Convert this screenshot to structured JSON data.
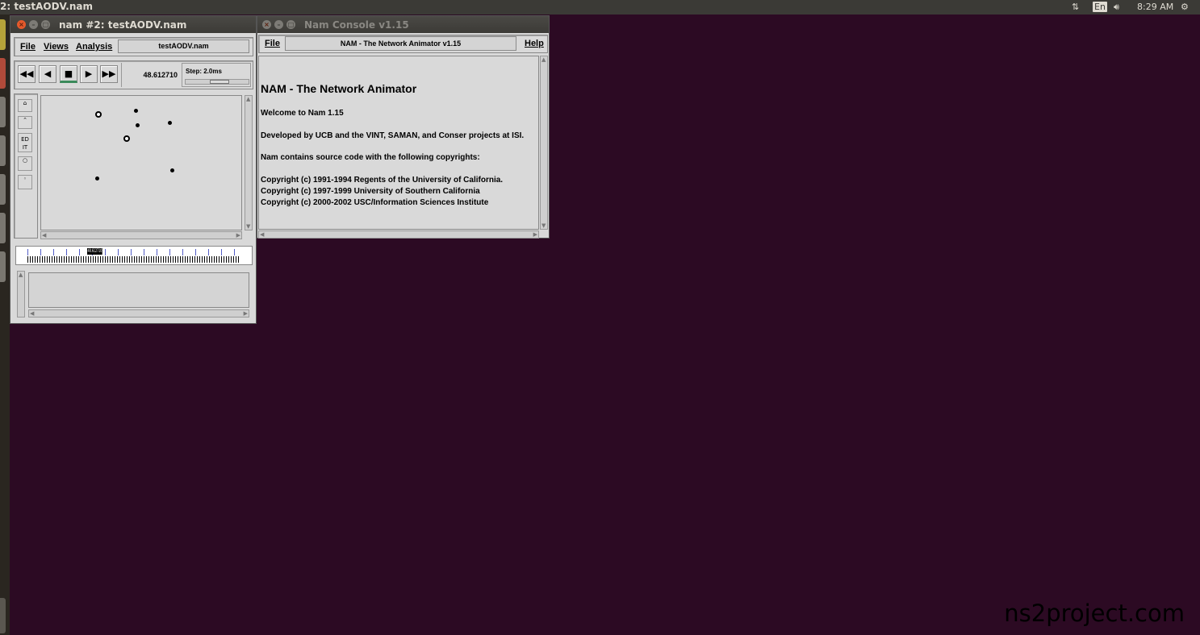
{
  "topbar": {
    "title": "2: testAODV.nam",
    "lang": "En",
    "time": "8:29 AM"
  },
  "nam_window": {
    "title": "nam #2: testAODV.nam",
    "menus": [
      "File",
      "Views",
      "Analysis"
    ],
    "file_field": "testAODV.nam",
    "time_value": "48.612710",
    "step_label": "Step: 2.0ms",
    "playback": [
      "rewind-icon",
      "play-back-icon",
      "stop-icon",
      "play-icon",
      "fast-forward-icon"
    ],
    "edit_label": "ED IT",
    "timeline_marker": "48.612710"
  },
  "console_window": {
    "title": "Nam Console v1.15",
    "menu_file": "File",
    "menu_help": "Help",
    "header_field": "NAM - The Network Animator v1.15",
    "heading": "NAM - The Network Animator",
    "lines": [
      "Welcome to Nam 1.15",
      "Developed by UCB and the VINT, SAMAN, and Conser projects at ISI.",
      "Nam contains source code with the following copyrights:",
      "Copyright (c) 1991-1994 Regents of the University of California.",
      "Copyright (c) 1997-1999 University of Southern California",
      "Copyright (c) 2000-2002 USC/Information Sciences Institute"
    ]
  },
  "watermark": "ns2project.com"
}
